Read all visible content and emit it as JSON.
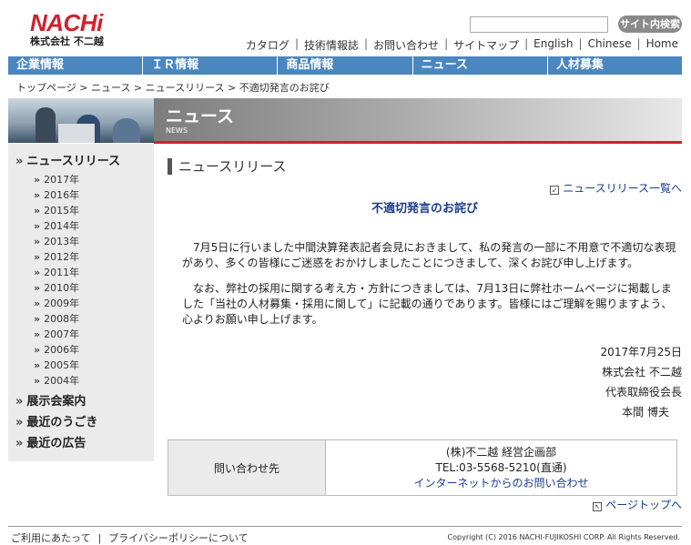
{
  "header": {
    "logo_text": "NACHi",
    "logo_sub": "株式会社 不二越",
    "search_placeholder": "",
    "search_button": "サイト内検索",
    "util_links": [
      "カタログ",
      "技術情報誌",
      "お問い合わせ",
      "サイトマップ",
      "English",
      "Chinese",
      "Home"
    ]
  },
  "global_nav": [
    "企業情報",
    "ＩＲ情報",
    "商品情報",
    "ニュース",
    "人材募集"
  ],
  "breadcrumb": "トップページ > ニュース > ニュースリリース > 不適切発言のお詫び",
  "banner": {
    "title": "ニュース",
    "subtitle": "NEWS"
  },
  "sidebar": {
    "news_release": "ニュースリリース",
    "years": [
      "2017年",
      "2016年",
      "2015年",
      "2014年",
      "2013年",
      "2012年",
      "2011年",
      "2010年",
      "2009年",
      "2008年",
      "2007年",
      "2006年",
      "2005年",
      "2004年"
    ],
    "exhibitions": "展示会案内",
    "recent": "最近のうごき",
    "ads": "最近の広告"
  },
  "main": {
    "section_title": "ニュースリリース",
    "list_link": "ニュースリリース一覧へ",
    "article_title": "不適切発言のお詫び",
    "para1": "7月5日に行いました中間決算発表記者会見におきまして、私の発言の一部に不用意で不適切な表現があり、多くの皆様にご迷惑をおかけしましたことにつきまして、深くお詫び申し上げます。",
    "para2": "なお、弊社の採用に関する考え方・方針につきましては、7月13日に弊社ホームページに掲載しました「当社の人材募集・採用に関して」に記載の通りであります。皆様にはご理解を賜りますよう、心よりお願い申し上げます。",
    "date": "2017年7月25日",
    "company": "株式会社 不二越",
    "position": "代表取締役会長",
    "name": "本間 博夫"
  },
  "contact": {
    "label": "問い合わせ先",
    "dept": "(株)不二越 経営企画部",
    "tel": "TEL:03-5568-5210(直通)",
    "internet_link": "インターネットからのお問い合わせ"
  },
  "page_top": "ページトップへ",
  "footer": {
    "terms": "ご利用にあたって",
    "privacy": "プライバシーポリシーについて",
    "copyright": "Copyright (C) 2016 NACHI-FUJIKOSHI CORP. All Rights Reserved."
  },
  "colors": {
    "brand_red": "#d11f2e",
    "nav_blue": "#4a86c0",
    "link_blue": "#1a3c8f"
  }
}
